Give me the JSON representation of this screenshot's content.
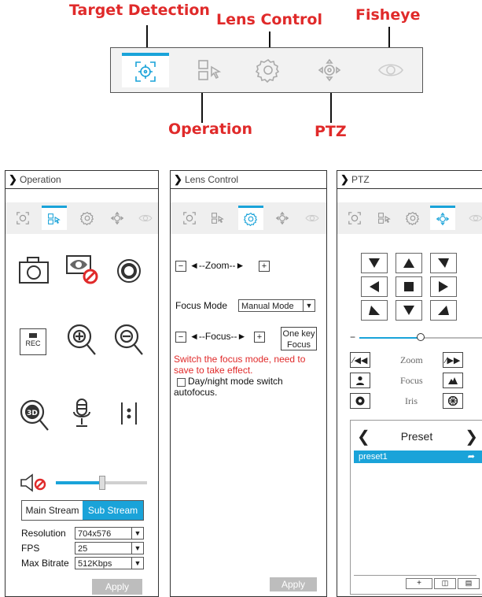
{
  "callouts": {
    "target_detection": "Target Detection",
    "lens_control": "Lens Control",
    "fisheye": "Fisheye",
    "operation": "Operation",
    "ptz": "PTZ"
  },
  "operation_panel": {
    "title": "Operation",
    "stream_tabs": [
      "Main Stream",
      "Sub Stream"
    ],
    "fields": [
      {
        "label": "Resolution",
        "value": "704x576"
      },
      {
        "label": "FPS",
        "value": "25"
      },
      {
        "label": "Max Bitrate",
        "value": "512Kbps"
      }
    ],
    "apply": "Apply",
    "rec_label": "REC",
    "volume_level": 0.5
  },
  "lens_panel": {
    "title": "Lens Control",
    "zoom_label": "◄--Zoom--►",
    "focus_mode_label": "Focus Mode",
    "focus_mode_value": "Manual Mode",
    "focus_label": "◄--Focus--►",
    "one_key_focus": "One key Focus",
    "warning": "Switch the focus mode, need to save to take effect.",
    "daynight_label": "Day/night mode switch autofocus.",
    "apply": "Apply"
  },
  "ptz_panel": {
    "title": "PTZ",
    "zoom": "Zoom",
    "focus": "Focus",
    "iris": "Iris",
    "preset_title": "Preset",
    "presets": [
      "preset1"
    ],
    "speed_level": 0.5
  },
  "colors": {
    "accent": "#1aa3d9",
    "callout": "#e02a2a",
    "warning": "#e02a2a"
  }
}
